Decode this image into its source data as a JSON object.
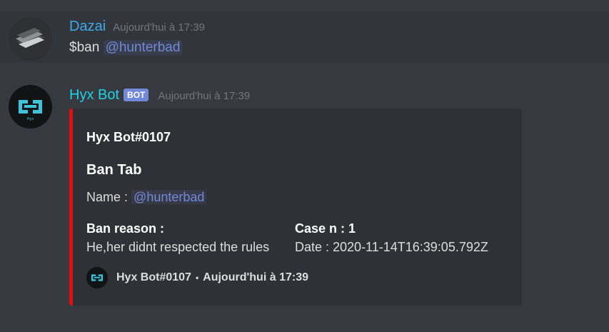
{
  "messages": [
    {
      "username": "Dazai",
      "username_color": "#3ea8ea",
      "timestamp": "Aujourd'hui à 17:39",
      "content_prefix": "$ban",
      "mention": "@hunterbad"
    },
    {
      "username": "Hyx Bot",
      "username_color": "#1fd3e6",
      "bot_tag": "BOT",
      "timestamp": "Aujourd'hui à 17:39",
      "embed": {
        "color": "#e30e0e",
        "author": "Hyx Bot#0107",
        "title": "Ban Tab",
        "description_prefix": "Name :",
        "description_mention": "@hunterbad",
        "fields": [
          {
            "name": "Ban reason :",
            "value": "He,her didnt respected the rules"
          },
          {
            "name": "Case n : 1",
            "value": "Date : 2020-11-14T16:39:05.792Z"
          }
        ],
        "footer_text": "Hyx Bot#0107",
        "footer_separator": "•",
        "footer_timestamp": "Aujourd'hui à 17:39"
      }
    }
  ],
  "icons": {
    "dazai_avatar": "layered-stripes-avatar",
    "bot_avatar": "hyx-logo-avatar"
  }
}
